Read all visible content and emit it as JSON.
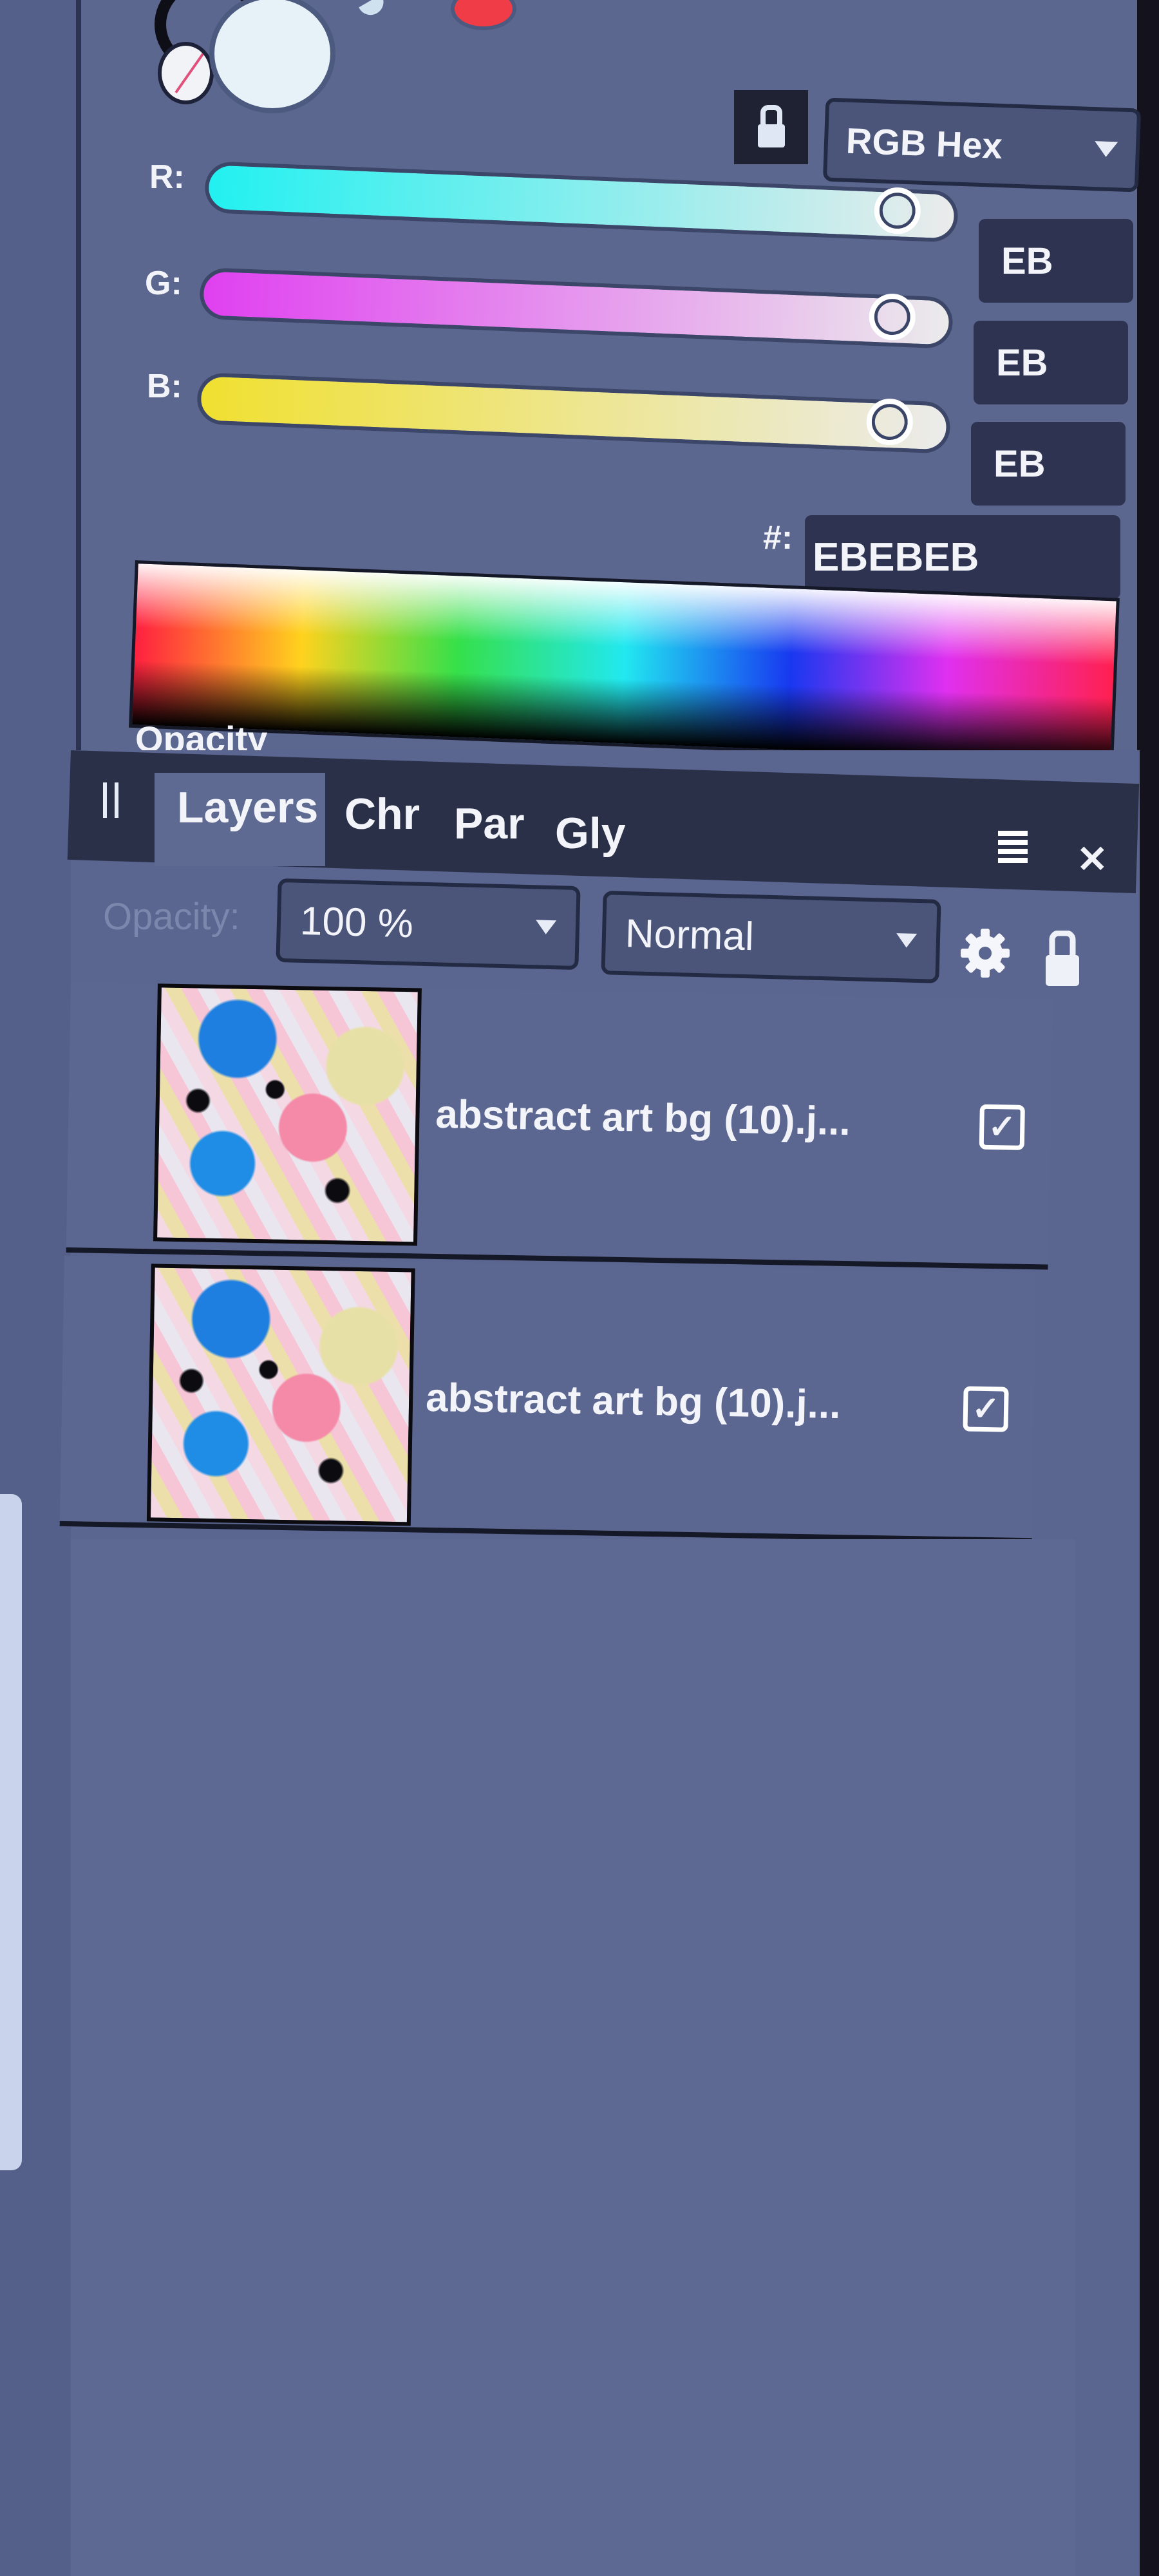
{
  "color_panel": {
    "swatches": {
      "fill_color": "#EBEBEB",
      "none_swatch": "none",
      "recent_color": "#F03C46"
    },
    "lock_icon": "lock-icon",
    "color_mode": "RGB Hex",
    "channels": [
      {
        "label": "R:",
        "value": "EB",
        "fraction": 0.92,
        "gradient": [
          "#22f0f0",
          "#ebebeb"
        ]
      },
      {
        "label": "G:",
        "value": "EB",
        "fraction": 0.92,
        "gradient": [
          "#e040f0",
          "#ebebeb"
        ]
      },
      {
        "label": "B:",
        "value": "EB",
        "fraction": 0.92,
        "gradient": [
          "#f0e030",
          "#ebebeb"
        ]
      }
    ],
    "hex_label": "#:",
    "hex_value": "EBEBEB",
    "opacity_label": "Opacity"
  },
  "layers_panel": {
    "tabs": [
      {
        "label": "Layers",
        "active": true
      },
      {
        "label": "Chr",
        "active": false
      },
      {
        "label": "Par",
        "active": false
      },
      {
        "label": "Gly",
        "active": false
      }
    ],
    "menu_icon": "panel-menu-icon",
    "close_icon": "close-icon",
    "opacity_label": "Opacity:",
    "opacity_value": "100 %",
    "blend_mode": "Normal",
    "settings_icon": "gear-icon",
    "lock_icon": "lock-icon",
    "layers": [
      {
        "name": "abstract art bg (10).j...",
        "visible": true,
        "check": "✓"
      },
      {
        "name": "abstract art bg (10).j...",
        "visible": true,
        "check": "✓"
      }
    ]
  }
}
